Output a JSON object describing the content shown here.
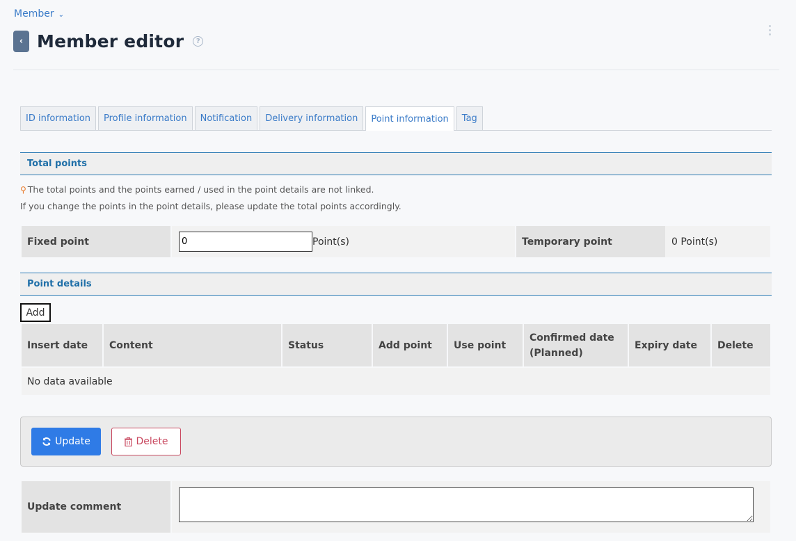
{
  "breadcrumb": {
    "label": "Member"
  },
  "header": {
    "title": "Member editor",
    "help": "?"
  },
  "tabs": [
    {
      "label": "ID information"
    },
    {
      "label": "Profile information"
    },
    {
      "label": "Notification"
    },
    {
      "label": "Delivery information"
    },
    {
      "label": "Point information",
      "active": true
    },
    {
      "label": "Tag"
    }
  ],
  "total_points": {
    "heading": "Total points",
    "note_line1": "The total points and the points earned / used in the point details are not linked.",
    "note_line2": "If you change the points in the point details, please update the total points accordingly.",
    "fixed_label": "Fixed point",
    "fixed_value": "0",
    "fixed_unit": "Point(s)",
    "temporary_label": "Temporary point",
    "temporary_value": "0 Point(s)"
  },
  "point_details": {
    "heading": "Point details",
    "add_label": "Add",
    "columns": [
      "Insert date",
      "Content",
      "Status",
      "Add point",
      "Use point",
      "Confirmed date (Planned)",
      "Expiry date",
      "Delete"
    ],
    "empty_text": "No data available"
  },
  "actions": {
    "update_label": "Update",
    "delete_label": "Delete"
  },
  "comment": {
    "label": "Update comment",
    "value": ""
  },
  "colors": {
    "accent": "#2f7be6",
    "link": "#3a7bc8",
    "danger": "#c8475e",
    "section": "#1f6fa8"
  }
}
